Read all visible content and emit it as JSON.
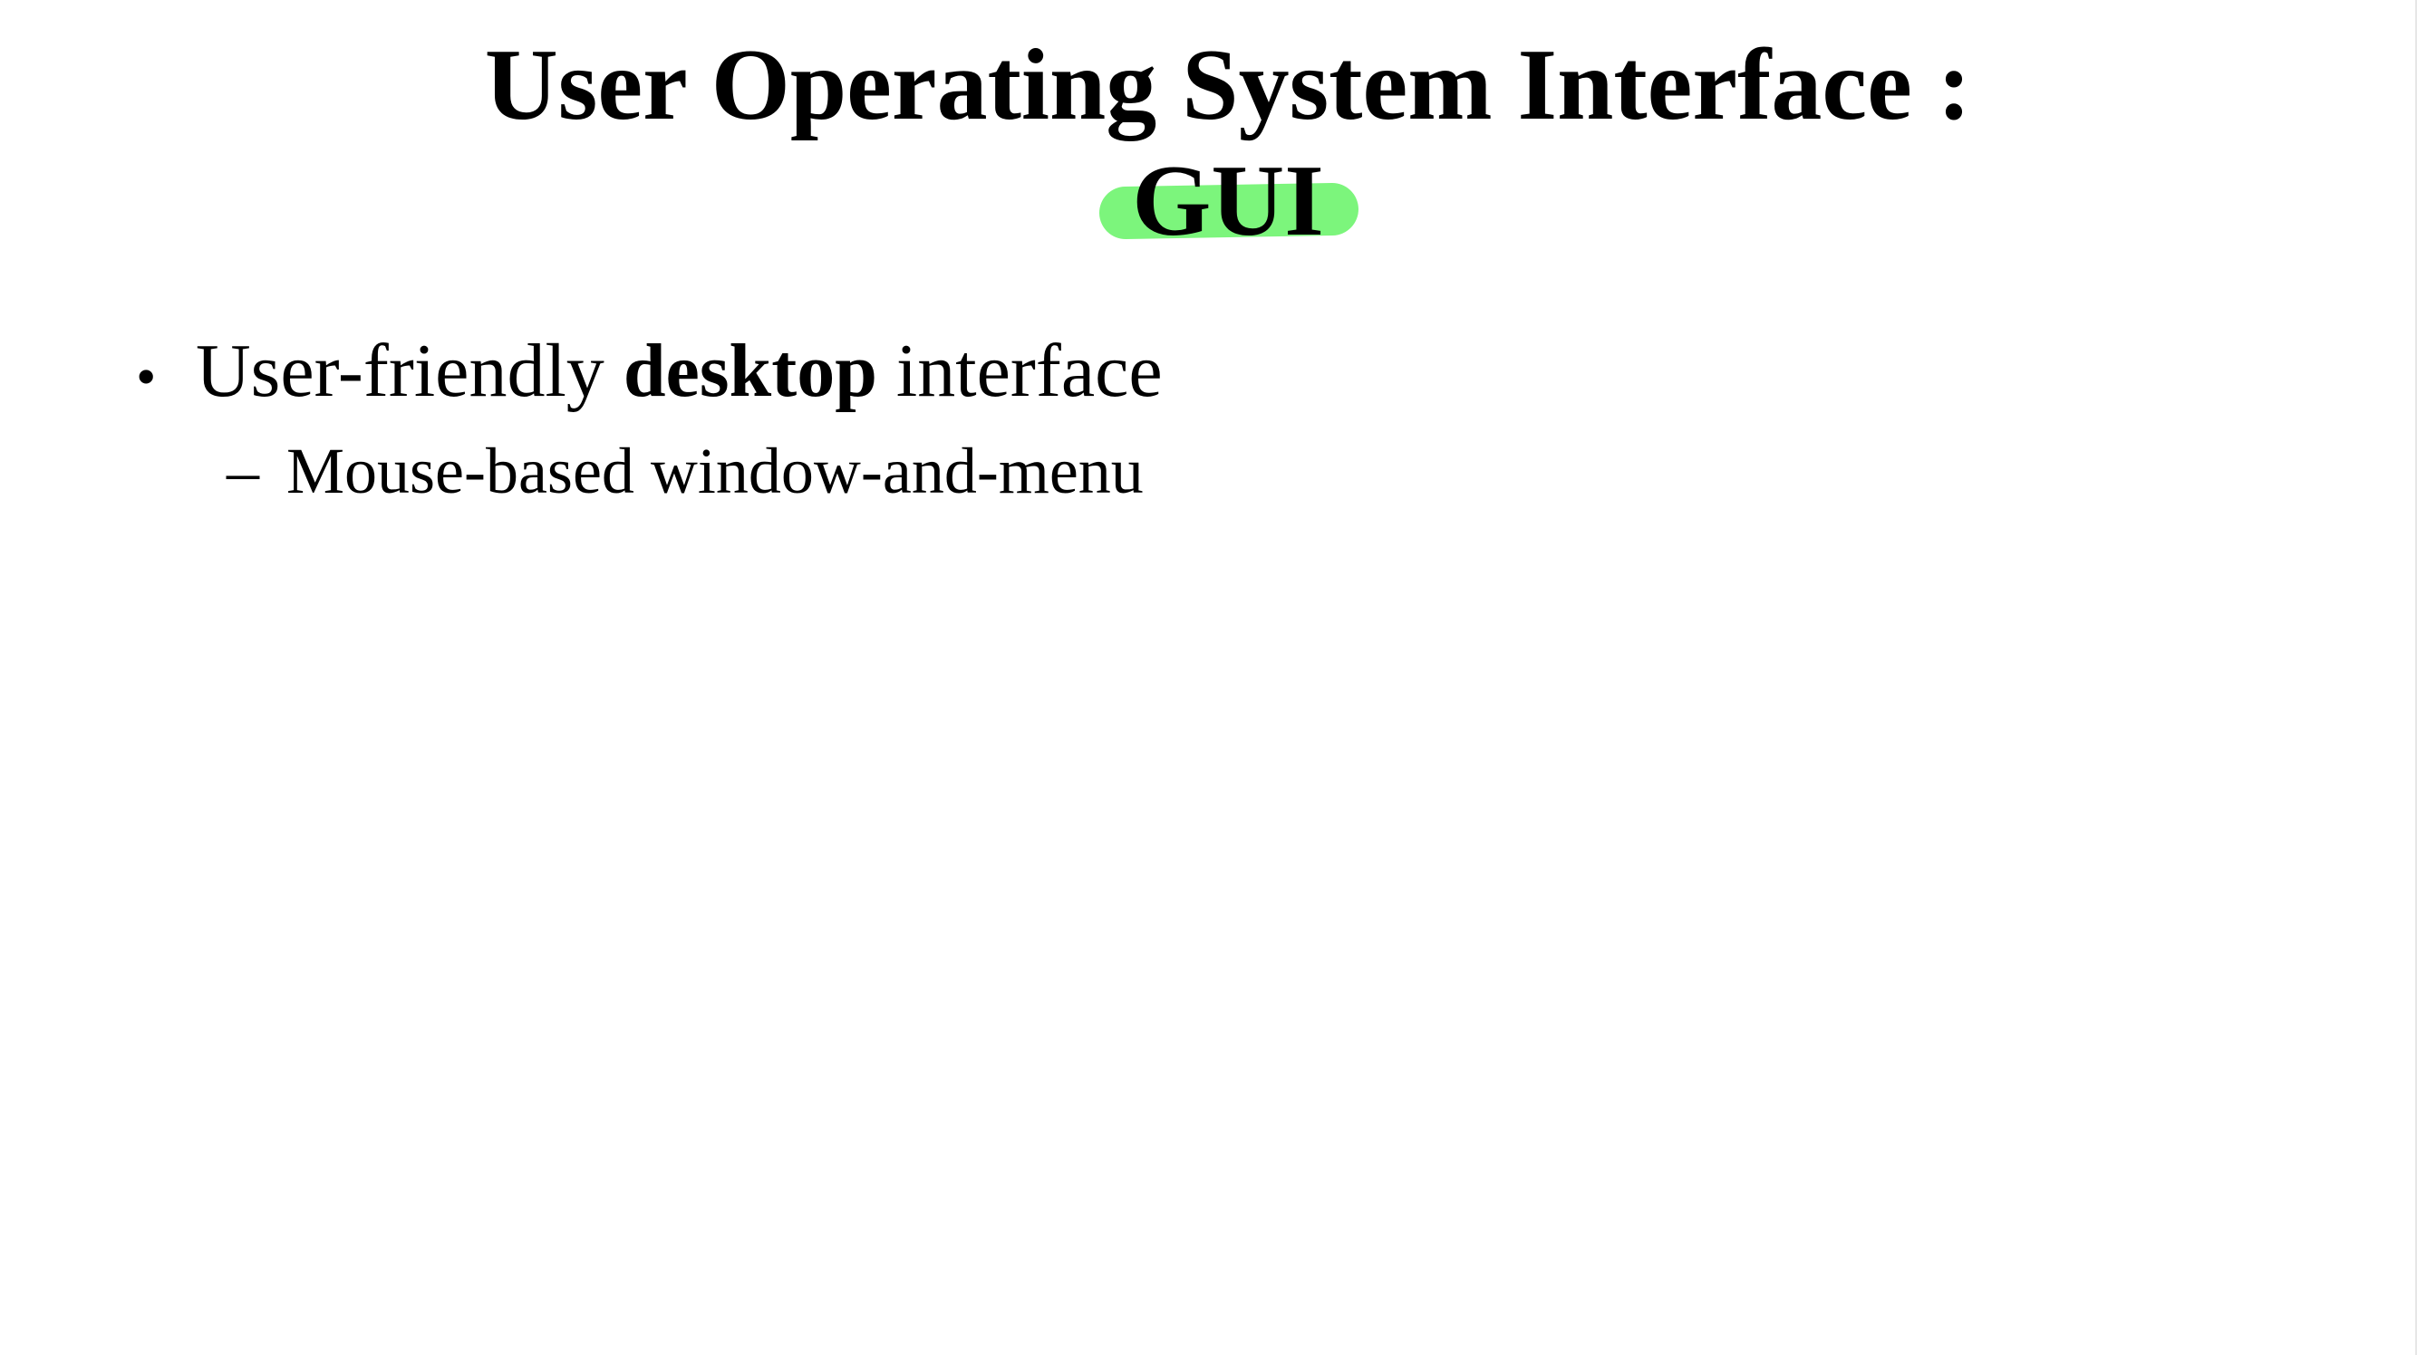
{
  "slide": {
    "title_line1": "User Operating System Interface :",
    "title_line2": "GUI",
    "highlight_color": "#7cf57c",
    "bullets": [
      {
        "marker": "•",
        "text_before": "User-friendly ",
        "text_bold": "desktop",
        "text_after": " interface",
        "sub_items": [
          {
            "marker": "–",
            "text": "Mouse-based window-and-menu"
          }
        ]
      }
    ]
  }
}
